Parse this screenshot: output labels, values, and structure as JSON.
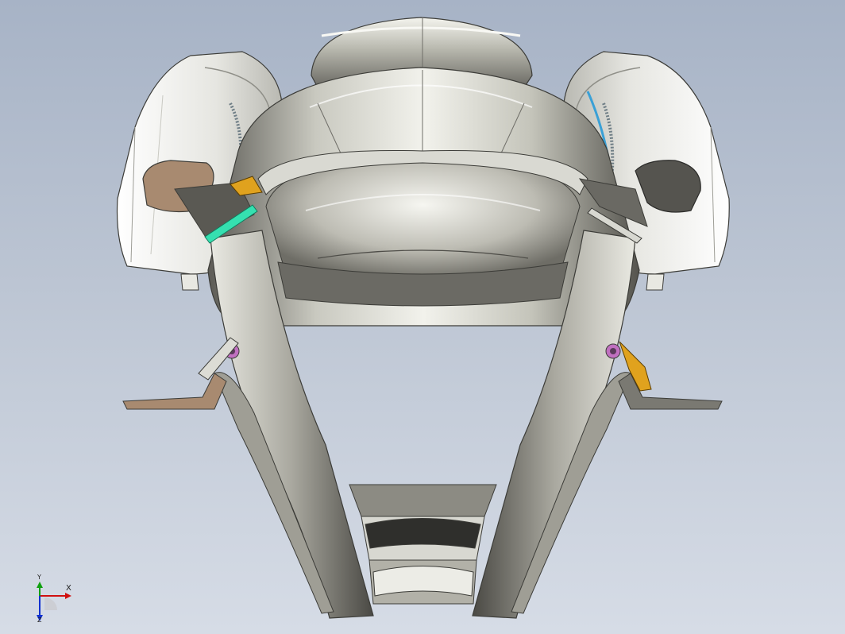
{
  "viewport": {
    "model_name": "respirator-mask",
    "background_top": "#a7b3c6",
    "background_bottom": "#d6dce6"
  },
  "colors": {
    "body_metal": "#b9b9ad",
    "cartridge_white": "#ededea",
    "strap_gray": "#8d8c83",
    "copper_tab": "#a88a70",
    "dark_tab": "#55544f",
    "clip_yellow": "#e0a21e",
    "pin_green": "#35e0b0",
    "seal_blue": "#3aa0d6",
    "gasket_purple": "#c070c0",
    "axis_x": "#d01010",
    "axis_y": "#10a010",
    "axis_z": "#1030d0"
  },
  "triad": {
    "x_label": "X",
    "y_label": "Y",
    "z_label": "Z"
  }
}
